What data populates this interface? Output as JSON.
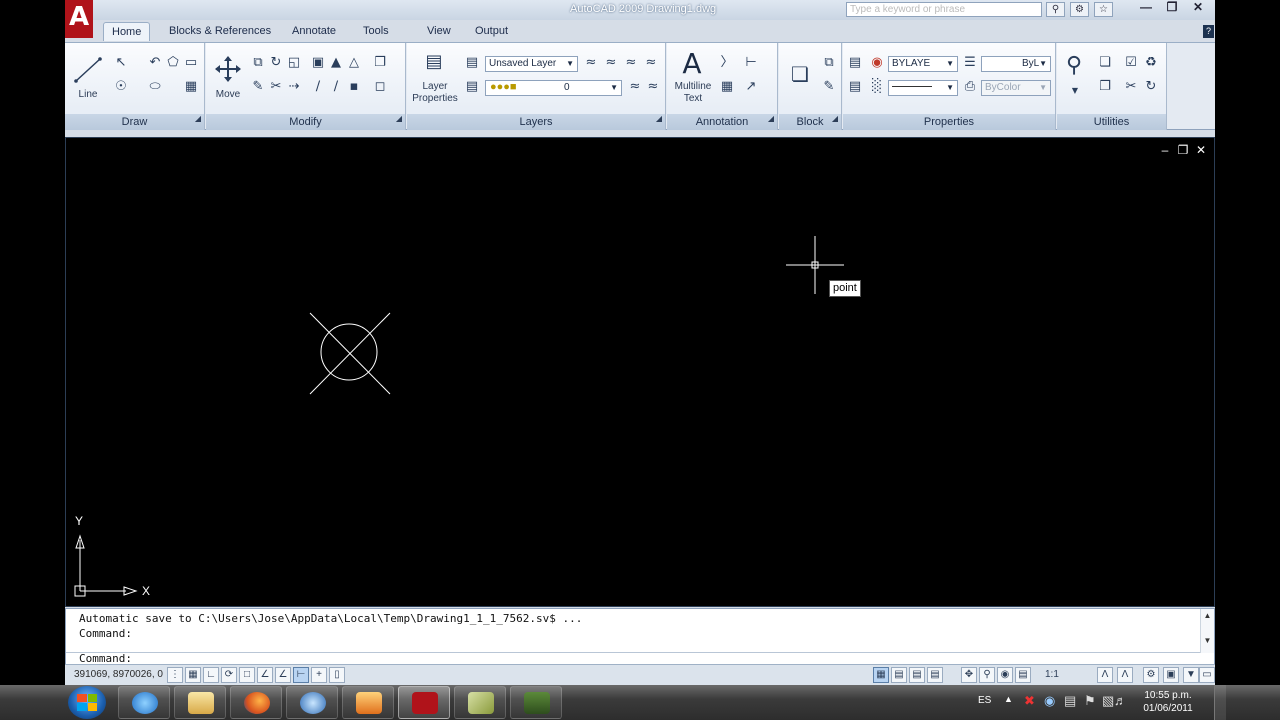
{
  "window": {
    "title": "AutoCAD 2009 Drawing1.dwg",
    "help_placeholder": "Type a keyword or phrase",
    "help_buttons": [
      "search-icon",
      "subscription-icon",
      "favorites-icon"
    ],
    "controls": [
      "minimize",
      "restore",
      "close"
    ]
  },
  "ribbon_tabs": [
    {
      "label": "Home",
      "active": true
    },
    {
      "label": "Blocks & References",
      "active": false
    },
    {
      "label": "Annotate",
      "active": false
    },
    {
      "label": "Tools",
      "active": false
    },
    {
      "label": "View",
      "active": false
    },
    {
      "label": "Output",
      "active": false
    }
  ],
  "panels": {
    "draw": {
      "title": "Draw",
      "line_label": "Line"
    },
    "modify": {
      "title": "Modify",
      "move_label": "Move"
    },
    "layers": {
      "title": "Layers",
      "layer_properties_label": "Layer\nProperties",
      "layer_dropdown": "Unsaved Layer",
      "layer_state": "0"
    },
    "annotation": {
      "title": "Annotation",
      "mtext_label": "Multiline\nText"
    },
    "block": {
      "title": "Block"
    },
    "properties": {
      "title": "Properties",
      "color": "BYLAYE",
      "lineweight": "ByL",
      "plotstyle": "ByColor"
    },
    "utilities": {
      "title": "Utilities"
    }
  },
  "drawing": {
    "cursor_tooltip": "point",
    "ucs_x": "X",
    "ucs_y": "Y"
  },
  "command_line": {
    "history_1": "Automatic save to C:\\Users\\Jose\\AppData\\Local\\Temp\\Drawing1_1_1_7562.sv$ ...",
    "history_2": "Command:",
    "prompt": "Command:"
  },
  "status_bar": {
    "coordinates": "391069, 8970026, 0",
    "annotation_scale": "1:1"
  },
  "taskbar": {
    "language": "ES",
    "time": "10:55 p.m.",
    "date": "01/06/2011",
    "apps": [
      "internet-explorer",
      "windows-explorer",
      "firefox",
      "media-player",
      "windows-media",
      "autocad",
      "sketch-app",
      "camtasia"
    ]
  },
  "colors": {
    "ribbon_bg": "#e4eaf2",
    "viewport_bg": "#000000",
    "autocad_red": "#b0131a",
    "taskbar_bg": "#2d2d2d"
  }
}
